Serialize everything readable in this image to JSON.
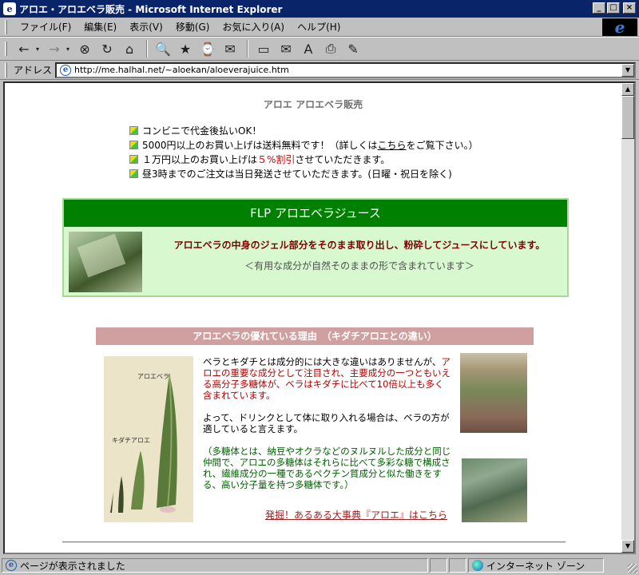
{
  "window": {
    "title": "アロエ・アロエベラ販売 - Microsoft Internet Explorer",
    "minimize": "_",
    "maximize": "□",
    "close": "×"
  },
  "menu": [
    "ファイル(F)",
    "編集(E)",
    "表示(V)",
    "移動(G)",
    "お気に入り(A)",
    "ヘルプ(H)"
  ],
  "toolbar": {
    "back": "←",
    "forward": "→",
    "dropdown": "▾",
    "stop": "⊗",
    "refresh": "↻",
    "home": "⌂",
    "search": "🔍",
    "favorites": "★",
    "history": "⌚",
    "channels": "✉",
    "fullscreen": "▭",
    "mail": "✉",
    "font": "A",
    "print": "⎙",
    "edit": "✎"
  },
  "address": {
    "label": "アドレス",
    "url": "http://me.halhal.net/~aloekan/aloeverajuice.htm"
  },
  "page": {
    "heading": "アロエ アロエベラ販売",
    "bullets": {
      "b1": "コンビニで代金後払いOK！",
      "b2_pre": "5000円以上のお買い上げは送料無料です！（詳しくは",
      "b2_link": "こちら",
      "b2_post": "をご覧下さい。）",
      "b3_pre": "１万円以上のお買い上げは",
      "b3_red": "５%割引",
      "b3_post": "させていただきます。",
      "b4": "昼3時までのご注文は当日発送させていただきます。(日曜・祝日を除く)"
    },
    "flp": {
      "title": "FLP アロエベラジュース",
      "main": "アロエベラの中身のジェル部分をそのまま取り出し、粉砕してジュースにしています。",
      "sub": "＜有用な成分が自然そのままの形で含まれています＞"
    },
    "reason": {
      "title": "アロエベラの優れている理由　（キダチアロエとの違い）",
      "leaf_label_top": "アロエベラ",
      "leaf_label_bottom": "キダチアロエ",
      "p1_a": "ベラとキダチとは成分的には大きな違いはありませんが、",
      "p1_b": "アロエの重要な成分として注目され、主要成分の一つともいえる高分子多糖体が、ベラはキダチに比べて10倍以上も多く含まれています。",
      "p2": "よって、ドリンクとして体に取り入れる場合は、ベラの方が適していると言えます。",
      "p3": "（多糖体とは、納豆やオクラなどのヌルヌルした成分と同じ仲間で、アロエの多糖体はそれらに比べて多彩な糖で構成され、繊維成分の一種であるペクチン質成分と似た働きをする、高い分子量を持つ多糖体です。）",
      "link": "発掘！あるある大事典『アロエ』はこちら"
    }
  },
  "status": {
    "text": "ページが表示されました",
    "zone": "インターネット ゾーン"
  }
}
